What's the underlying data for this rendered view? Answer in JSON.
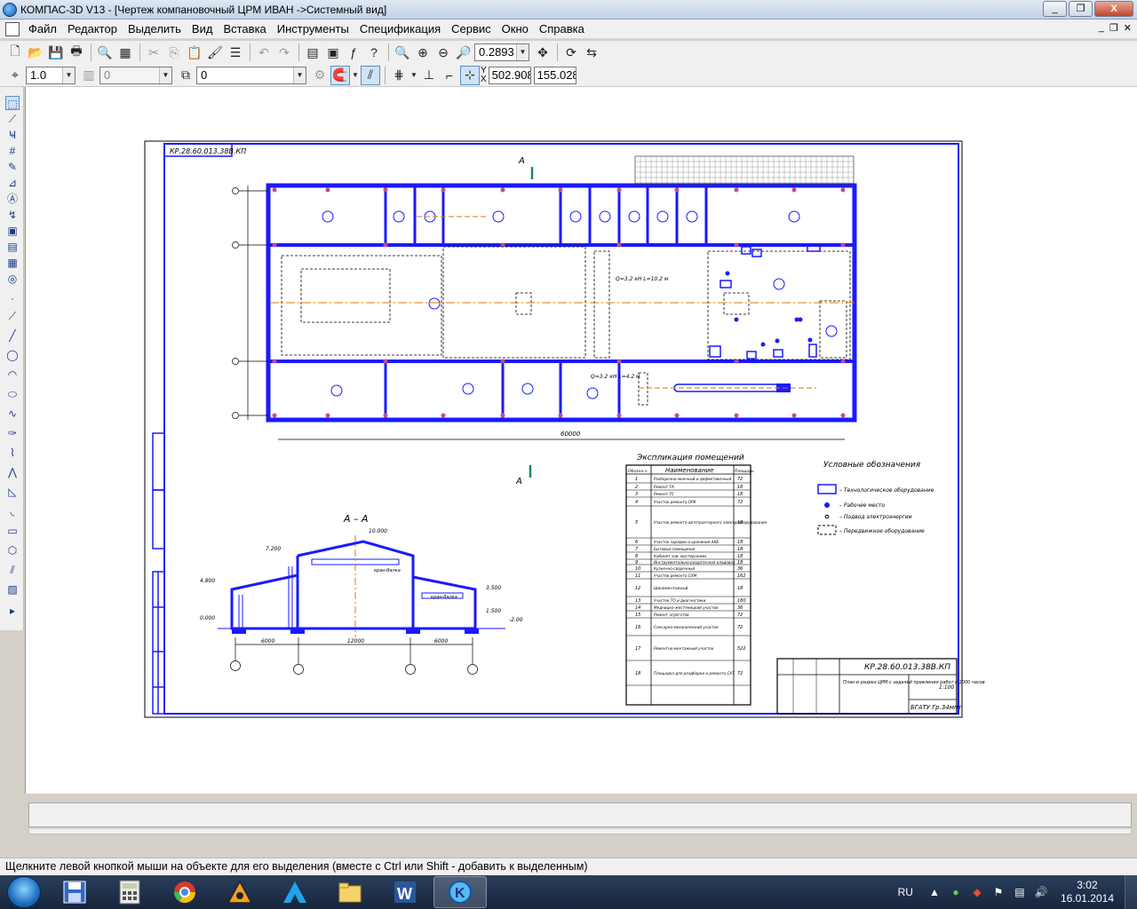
{
  "window": {
    "title": "КОМПАС-3D V13 - [Чертеж  компановочный ЦРМ ИВАН ->Системный вид]",
    "buttons": [
      "_",
      "❐",
      "X"
    ]
  },
  "menu": {
    "items": [
      "Файл",
      "Редактор",
      "Выделить",
      "Вид",
      "Вставка",
      "Инструменты",
      "Спецификация",
      "Сервис",
      "Окно",
      "Справка"
    ],
    "mdi_buttons": [
      "_",
      "❐",
      "✕"
    ]
  },
  "toolbar1": {
    "zoom_value": "0.2893"
  },
  "toolbar2": {
    "step_value": "1.0",
    "angle_value": "0",
    "layer_value": "0",
    "x_value": "502.908",
    "y_value": "155.028",
    "x_label": "X",
    "y_label": "Y"
  },
  "drawing": {
    "stamp_code": "КР.28.60.013.38В.КП",
    "title_code": "КР.28.60.013.38В.КП",
    "section_arrow_top": "А",
    "section_arrow_bottom": "А",
    "section_title": "А – А",
    "overall_dim": "60000",
    "explication_title": "Экспликация помещений",
    "explication_headers": [
      "Обозна-ч.",
      "Наименование",
      "Площадь"
    ],
    "explication_rows": [
      {
        "n": "1",
        "name": "Разборочно-моечный и дефектовочный",
        "area": "72"
      },
      {
        "n": "2",
        "name": "Ремонт ТА",
        "area": "18"
      },
      {
        "n": "3",
        "name": "Ремонт ТС",
        "area": "18"
      },
      {
        "n": "4",
        "name": "Участок ремонта ОРК",
        "area": "72"
      },
      {
        "n": "5",
        "name": "Участок ремонта автотракторного электрооборудования",
        "area": "18"
      },
      {
        "n": "6",
        "name": "Участок зарядки и хранения АКБ",
        "area": "18"
      },
      {
        "n": "7",
        "name": "Бытовые помещения",
        "area": "18"
      },
      {
        "n": "8",
        "name": "Кабинет зав. мастерскими",
        "area": "18"
      },
      {
        "n": "9",
        "name": "Инструментально-раздаточная кладовая",
        "area": "18"
      },
      {
        "n": "10",
        "name": "Кузнечно-сварочный",
        "area": "36"
      },
      {
        "n": "11",
        "name": "Участок ремонта СХМ",
        "area": "162"
      },
      {
        "n": "12",
        "name": "Шиномонтажный",
        "area": "18"
      },
      {
        "n": "13",
        "name": "Участок ТО и диагностики",
        "area": "180"
      },
      {
        "n": "14",
        "name": "Медницко-жестяницкий участок",
        "area": "36"
      },
      {
        "n": "15",
        "name": "Ремонт агрегатов",
        "area": "72"
      },
      {
        "n": "16",
        "name": "Слесарно-механический участок",
        "area": "72"
      },
      {
        "n": "17",
        "name": "Ремонтно-монтажный участок",
        "area": "522"
      },
      {
        "n": "18",
        "name": "Площадка для раздборки и ремонта СХТ",
        "area": "72"
      }
    ],
    "legend_title": "Условные обозначения",
    "legend_items": [
      "– Технологическое оборудование",
      "– Рабочее место",
      "– Подвод электроэнергии",
      "– Передвижное оборудование"
    ],
    "crane_label_1": "Q=3.2 кН L=10.2 м",
    "crane_label_2": "Q=3.2 кН L=4.2 м",
    "title_block_desc": "План и разрез ЦРМ с задачей правления работ в 1000 часов",
    "title_block_scale": "1:100",
    "title_block_org": "БГАТУ Гр.34мпт",
    "elev_labels": [
      "10.000",
      "7.200",
      "4.800",
      "0.000",
      "3.500",
      "1.500",
      "-2.00"
    ],
    "section_dims": [
      "6000",
      "12000",
      "6000"
    ],
    "section_tags": [
      "кран-балка",
      "кран-балка"
    ]
  },
  "status_text": "Щелкните левой кнопкой мыши на объекте для его выделения (вместе с Ctrl или Shift - добавить к выделенным)",
  "taskbar": {
    "lang": "RU",
    "time": "3:02",
    "date": "16.01.2014"
  },
  "colors": {
    "drawing_blue": "#1a1aff",
    "axis_orange": "#e07a00",
    "title_bar": "#c2d3e8"
  }
}
